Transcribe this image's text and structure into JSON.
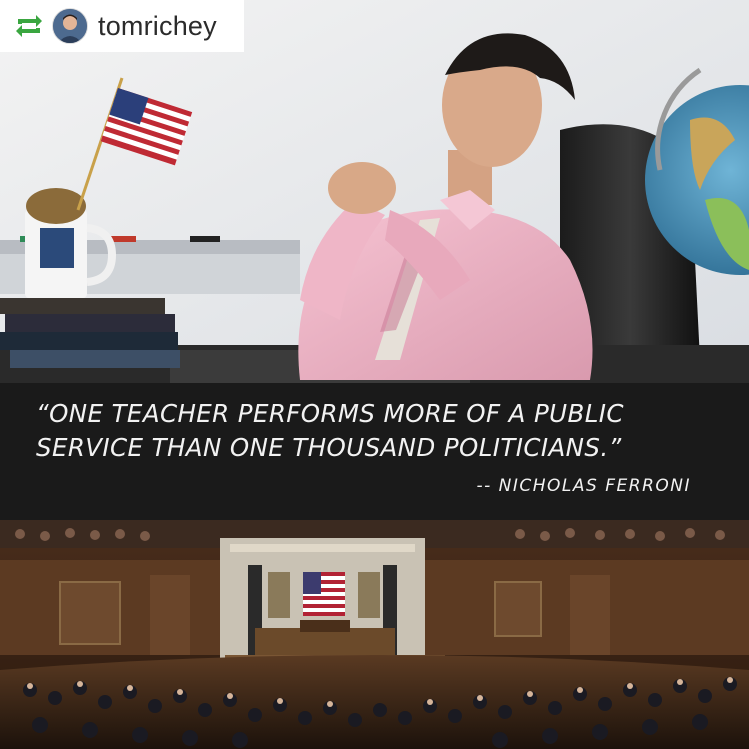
{
  "repost": {
    "icon": "repost-icon",
    "avatar_icon": "avatar",
    "username": "tomrichey"
  },
  "quote": {
    "text": "“One teacher performs more of a public service than one thousand politicians.”",
    "author": "-- Nicholas Ferroni"
  },
  "photos": {
    "top": "teacher-at-desk-photo",
    "bottom": "congress-chamber-photo"
  },
  "colors": {
    "quote_band": "#1a1a1a",
    "quote_text": "#f2f2f2",
    "repost_green": "#3aa640"
  }
}
